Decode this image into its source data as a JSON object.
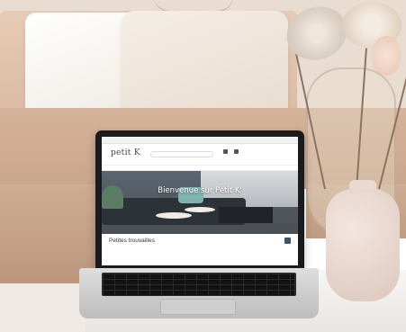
{
  "laptop_website": {
    "topbar": {
      "left_text": "",
      "links": [
        "",
        "",
        "",
        ""
      ]
    },
    "header": {
      "logo": "petit K",
      "search_placeholder": "",
      "icon_labels": [
        "",
        ""
      ]
    },
    "nav_items": [
      "",
      "",
      "",
      "",
      "",
      ""
    ],
    "hero": {
      "title": "Bienvenue sur Petit K'",
      "subtitle": ""
    },
    "section": {
      "title": "Petites trouvailles",
      "subtitle": ""
    }
  },
  "colors": {
    "sofa": "#d5b39b",
    "wall": "#e9dcd0",
    "laptop_bezel": "#1b1b1d",
    "hero_overlay": "#4a4f55",
    "accent": "#3b5563",
    "vase": "#e8d6cc"
  }
}
